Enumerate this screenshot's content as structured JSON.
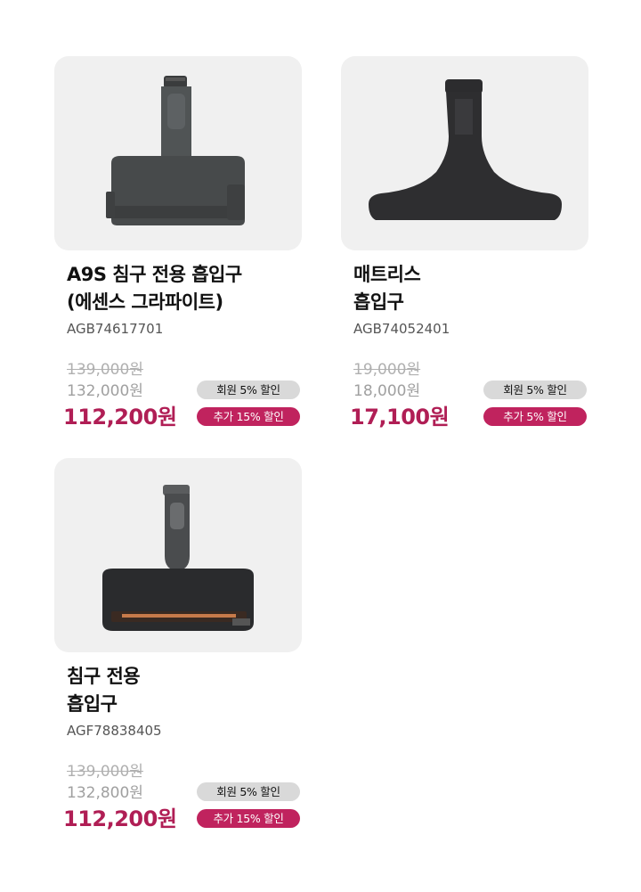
{
  "products": [
    {
      "name": "A9S 침구 전용 흡입구\n(에센스 그라파이트)",
      "code": "AGB74617701",
      "original_price": "139,000원",
      "member_price": "132,000원",
      "final_price": "112,200원",
      "badge_member": "회원 5% 할인",
      "badge_extra": "추가 15% 할인"
    },
    {
      "name": "매트리스\n흡입구",
      "code": "AGB74052401",
      "original_price": "19,000원",
      "member_price": "18,000원",
      "final_price": "17,100원",
      "badge_member": "회원 5% 할인",
      "badge_extra": "추가 5% 할인"
    },
    {
      "name": "침구 전용\n흡입구",
      "code": "AGF78838405",
      "original_price": "139,000원",
      "member_price": "132,800원",
      "final_price": "112,200원",
      "badge_member": "회원 5% 할인",
      "badge_extra": "추가 15% 할인"
    }
  ],
  "colors": {
    "card_bg": "#f0f0f0",
    "final_price": "#b01e55",
    "extra_badge": "#c0235e",
    "member_badge": "#d9d9d9"
  }
}
